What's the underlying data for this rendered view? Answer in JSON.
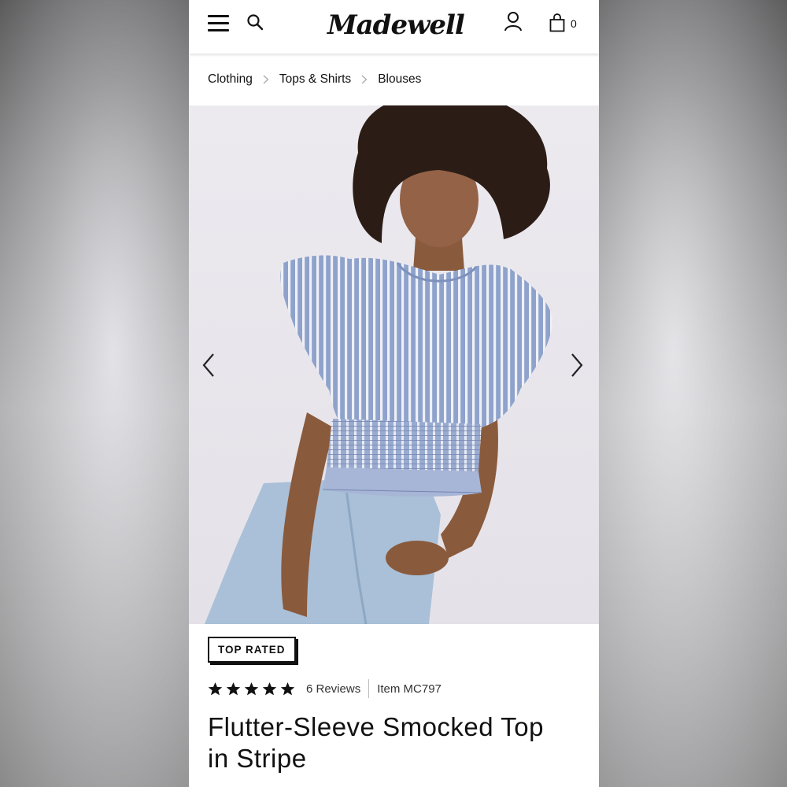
{
  "header": {
    "brand": "Madewell",
    "bag_count": "0",
    "icons": [
      "hamburger-menu-icon",
      "search-icon",
      "account-icon",
      "shopping-bag-icon"
    ]
  },
  "breadcrumb": [
    "Clothing",
    "Tops & Shirts",
    "Blouses"
  ],
  "carousel": {
    "prev_icon": "chevron-left-icon",
    "next_icon": "chevron-right-icon"
  },
  "product": {
    "badge": "TOP RATED",
    "rating": 5,
    "rating_max": 5,
    "reviews_label": "6 Reviews",
    "item_label": "Item MC797",
    "title_line1": "Flutter-Sleeve Smocked Top",
    "title_line2": "in Stripe"
  },
  "colors": {
    "text": "#111111",
    "stripe_blue": "#7f96c4",
    "denim": "#a9c0d8"
  }
}
